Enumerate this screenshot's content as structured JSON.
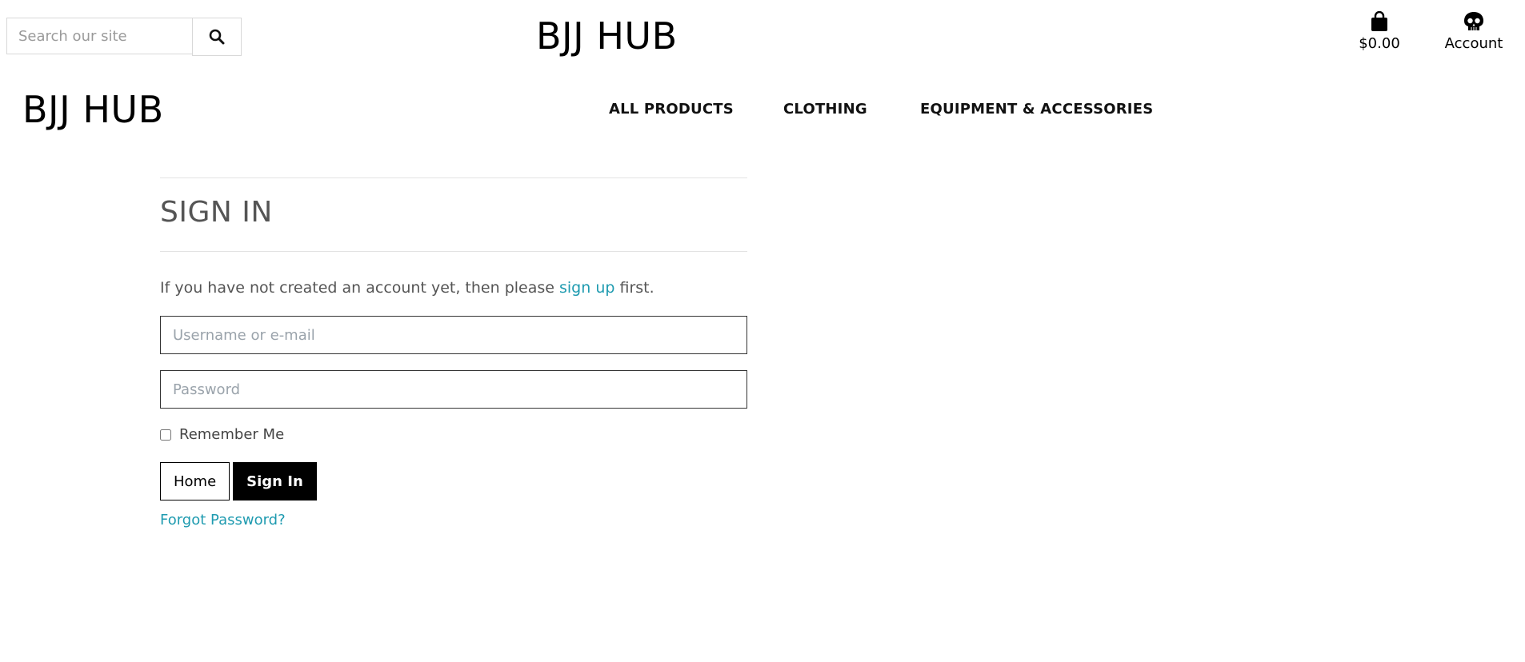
{
  "header": {
    "search": {
      "placeholder": "Search our site",
      "value": ""
    },
    "brand": "BJJ HUB",
    "cart": {
      "amount": "$0.00",
      "icon": "shopping-bag-icon"
    },
    "account": {
      "label": "Account",
      "icon": "skull-icon"
    }
  },
  "nav": {
    "brand": "BJJ HUB",
    "items": [
      {
        "label": "ALL PRODUCTS"
      },
      {
        "label": "CLOTHING"
      },
      {
        "label": "EQUIPMENT & ACCESSORIES"
      }
    ]
  },
  "signin": {
    "title": "SIGN IN",
    "intro_before": "If you have not created an account yet, then please ",
    "intro_link": "sign up",
    "intro_after": " first.",
    "username_placeholder": "Username or e-mail",
    "password_placeholder": "Password",
    "remember_label": "Remember Me",
    "remember_checked": false,
    "home_button": "Home",
    "signin_button": "Sign In",
    "forgot_link": "Forgot Password?"
  },
  "colors": {
    "link": "#1f9bb0",
    "primary_button": "#000000",
    "title": "#555555"
  }
}
